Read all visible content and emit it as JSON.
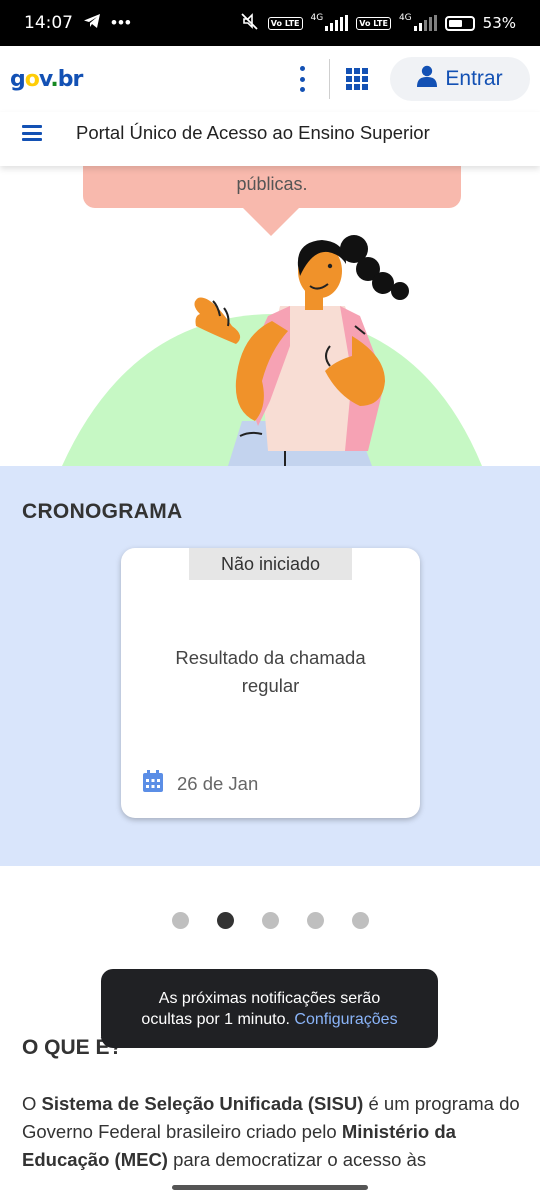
{
  "status_bar": {
    "time": "14:07",
    "network_1": "4G",
    "network_2": "4G",
    "lte_1": "Vo LTE",
    "lte_2": "Vo LTE",
    "battery": "53%",
    "icons": [
      "telegram-icon",
      "more-icon",
      "mute-icon",
      "signal-icon",
      "battery-icon"
    ]
  },
  "header": {
    "logo": {
      "g": "g",
      "o": "o",
      "v": "v",
      "dot": ".",
      "b": "b",
      "r": "r"
    },
    "login_label": "Entrar"
  },
  "subbar": {
    "title": "Portal Único de Acesso ao Ensino Superior"
  },
  "hero": {
    "bubble_text": "públicas."
  },
  "cronograma": {
    "title": "CRONOGRAMA",
    "card": {
      "status": "Não iniciado",
      "event_line1": "Resultado da chamada",
      "event_line2": "regular",
      "date": "26 de Jan"
    },
    "dots_count": 5,
    "active_dot": 2
  },
  "oque": {
    "title": "O QUE É?",
    "p1": "O ",
    "p1_b": "Sistema de Seleção Unificada (SISU)",
    "p2": " é um programa do Governo Federal brasileiro criado pelo ",
    "p2_b": "Ministério da Educação (MEC)",
    "p3": " para democratizar o acesso às"
  },
  "toast": {
    "line1": "As próximas notificações serão",
    "line2": "ocultas por 1 minuto.",
    "link": "Configurações"
  },
  "colors": {
    "brand_blue": "#1351b4",
    "section_bg": "#d9e5fb",
    "bubble": "#f8b9ad",
    "hill": "#c6f8c4"
  }
}
